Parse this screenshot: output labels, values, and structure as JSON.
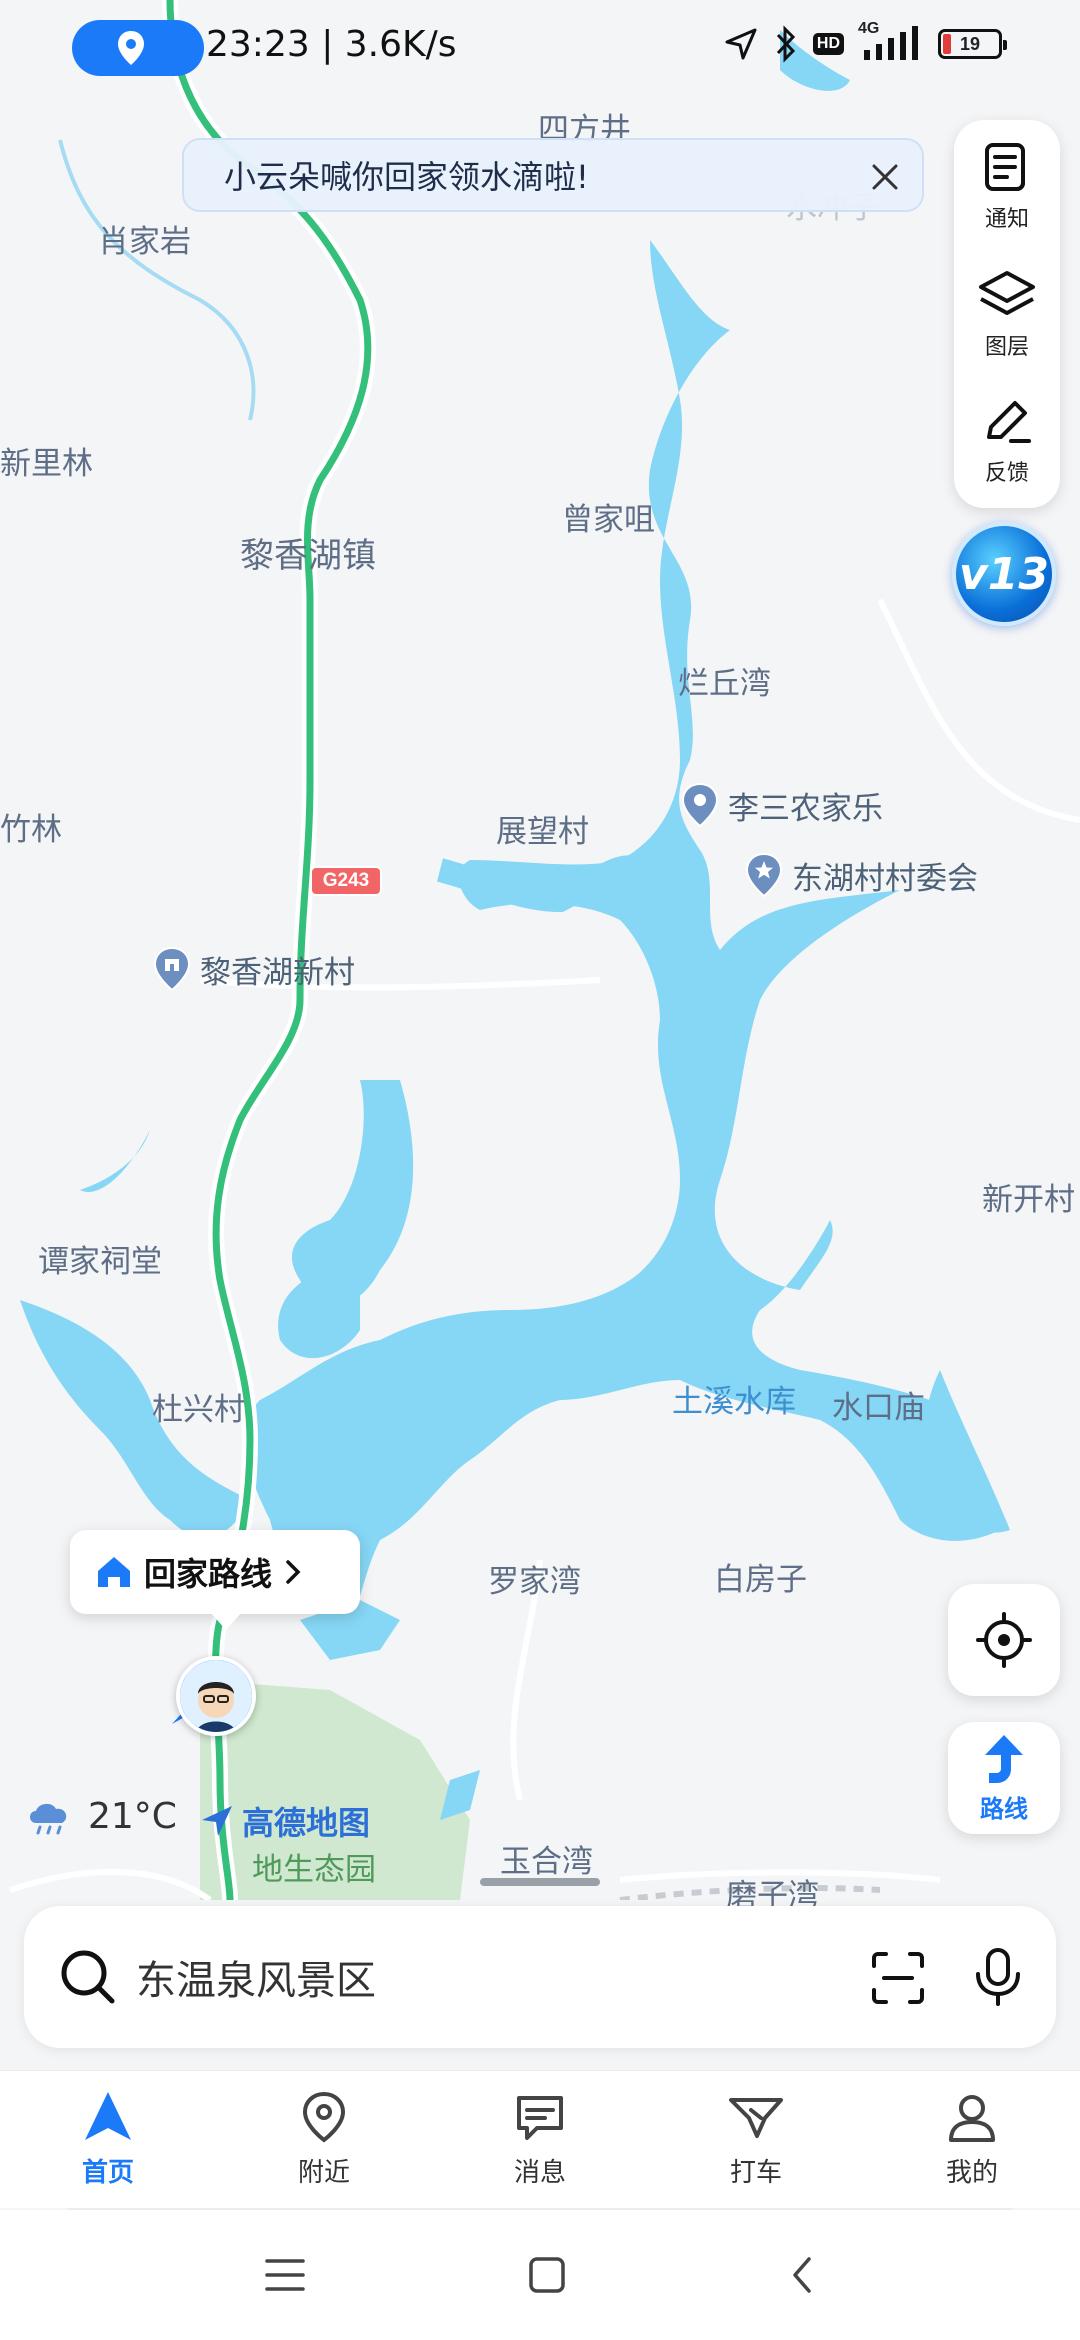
{
  "status_bar": {
    "time_speed": "23:23 | 3.6K/s",
    "network": "4G",
    "hd": "HD",
    "battery": "19"
  },
  "banner": {
    "text": "小云朵喊你回家领水滴啦!"
  },
  "side_panel": {
    "notify": "通知",
    "layers": "图层",
    "feedback": "反馈",
    "version_badge": "v13"
  },
  "map": {
    "labels": {
      "sifangjing": "四方井",
      "xiaojiayan": "肖家岩",
      "shuichong": "水冲子",
      "xinlilin": "新里林",
      "lixianghuzhen": "黎香湖镇",
      "zengjiaju": "曾家咀",
      "lanqiuwan": "烂丘湾",
      "zhulin": "竹林",
      "zhanwangcun": "展望村",
      "tanjiacitang": "谭家祠堂",
      "xinkaicun": "新开村",
      "duxingcun": "杜兴村",
      "tuxishuiku": "土溪水库",
      "shuikoumiao": "水口庙",
      "luojiawan": "罗家湾",
      "baifangzi": "白房子",
      "yuhewan": "玉合湾",
      "moziwan": "磨子湾",
      "shengtaiyuan": "地生态园"
    },
    "pois": {
      "lisannongjiale": "李三农家乐",
      "donghucun": "东湖村村委会",
      "lixianghuxincun": "黎香湖新村"
    },
    "road_shield": "G243"
  },
  "home_route": {
    "label": "回家路线"
  },
  "route_button": {
    "label": "路线"
  },
  "weather": {
    "temp": "21°C"
  },
  "brand": {
    "name": "高德地图"
  },
  "search": {
    "placeholder": "东温泉风景区"
  },
  "tabs": [
    {
      "label": "首页",
      "icon": "navigation-arrow-icon",
      "active": true
    },
    {
      "label": "附近",
      "icon": "location-pin-icon"
    },
    {
      "label": "消息",
      "icon": "message-icon"
    },
    {
      "label": "打车",
      "icon": "taxi-icon"
    },
    {
      "label": "我的",
      "icon": "person-icon"
    }
  ],
  "colors": {
    "accent": "#1a7af8",
    "water": "#86d6f5",
    "highway": "#34c07a",
    "land": "#f4f5f7",
    "park": "#cfe8cf"
  }
}
